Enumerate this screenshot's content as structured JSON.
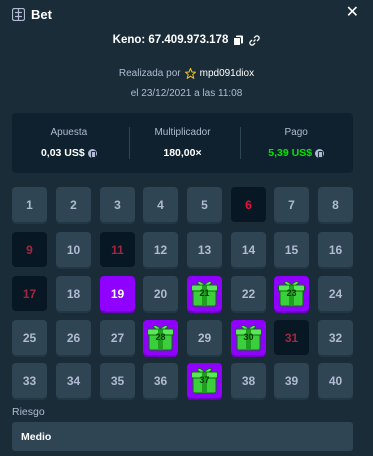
{
  "header": {
    "title": "Bet",
    "icon": "bet-slip-icon",
    "close_icon": "close-icon"
  },
  "game": {
    "id_text": "Keno: 67.409.973.178"
  },
  "placed_by": {
    "prefix": "Realizada por",
    "user": "mpd091diox",
    "user_icon": "star-icon"
  },
  "date_text": "el 23/12/2021 a las 11:08",
  "stats": {
    "bet": {
      "label": "Apuesta",
      "value": "0,03 US$"
    },
    "multiplier": {
      "label": "Multiplicador",
      "value": "180,00×"
    },
    "payout": {
      "label": "Pago",
      "value": "5,39 US$"
    }
  },
  "grid": {
    "tiles": [
      {
        "n": "1",
        "state": "default"
      },
      {
        "n": "2",
        "state": "default"
      },
      {
        "n": "3",
        "state": "default"
      },
      {
        "n": "4",
        "state": "default"
      },
      {
        "n": "5",
        "state": "default"
      },
      {
        "n": "6",
        "state": "drawn"
      },
      {
        "n": "7",
        "state": "default"
      },
      {
        "n": "8",
        "state": "default"
      },
      {
        "n": "9",
        "state": "drawn-dim"
      },
      {
        "n": "10",
        "state": "default"
      },
      {
        "n": "11",
        "state": "drawn-dim"
      },
      {
        "n": "12",
        "state": "default"
      },
      {
        "n": "13",
        "state": "default"
      },
      {
        "n": "14",
        "state": "default"
      },
      {
        "n": "15",
        "state": "default"
      },
      {
        "n": "16",
        "state": "default"
      },
      {
        "n": "17",
        "state": "drawn-dim"
      },
      {
        "n": "18",
        "state": "default"
      },
      {
        "n": "19",
        "state": "selected"
      },
      {
        "n": "20",
        "state": "default"
      },
      {
        "n": "21",
        "state": "hit"
      },
      {
        "n": "22",
        "state": "default"
      },
      {
        "n": "23",
        "state": "hit"
      },
      {
        "n": "24",
        "state": "default"
      },
      {
        "n": "25",
        "state": "default"
      },
      {
        "n": "26",
        "state": "default"
      },
      {
        "n": "27",
        "state": "default"
      },
      {
        "n": "28",
        "state": "hit"
      },
      {
        "n": "29",
        "state": "default"
      },
      {
        "n": "30",
        "state": "hit"
      },
      {
        "n": "31",
        "state": "drawn-dim"
      },
      {
        "n": "32",
        "state": "default"
      },
      {
        "n": "33",
        "state": "default"
      },
      {
        "n": "34",
        "state": "default"
      },
      {
        "n": "35",
        "state": "default"
      },
      {
        "n": "36",
        "state": "default"
      },
      {
        "n": "37",
        "state": "hit"
      },
      {
        "n": "38",
        "state": "default"
      },
      {
        "n": "39",
        "state": "default"
      },
      {
        "n": "40",
        "state": "default"
      }
    ]
  },
  "risk": {
    "label": "Riesgo",
    "value": "Medio"
  },
  "colors": {
    "bg": "#1a2c38",
    "panel": "#0f212e",
    "tile": "#2f4553",
    "selected": "#9000ff",
    "green": "#00e701",
    "red": "#e9113c"
  }
}
